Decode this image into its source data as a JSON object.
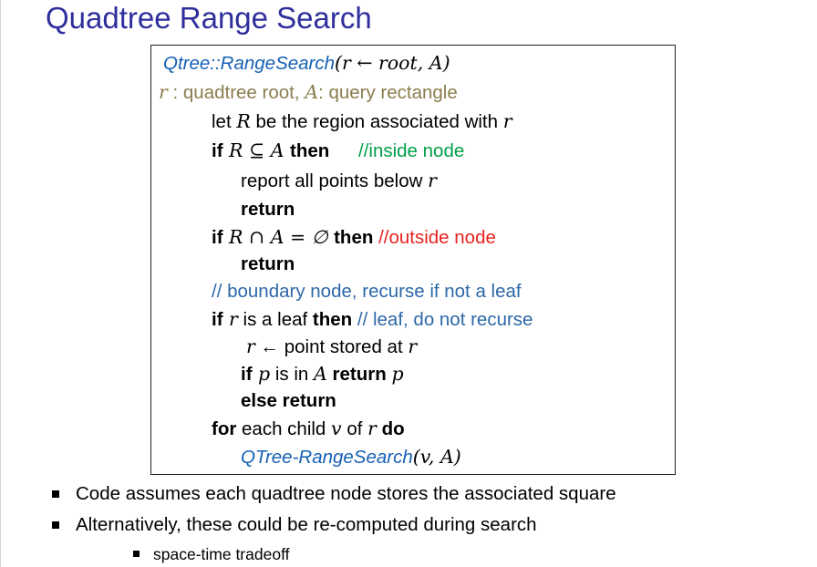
{
  "title": "Quadtree Range Search",
  "code": {
    "signature_fn": "Qtree::RangeSearch",
    "signature_args": "(r ← root, A)",
    "param_line": {
      "r": "r",
      "r_desc": " : quadtree root, ",
      "A": "A",
      "A_desc": ": query rectangle"
    },
    "line_let": {
      "pre": "let ",
      "R": "R",
      "mid": " be the region associated with ",
      "r": "r"
    },
    "line_if_inside": {
      "if": "if",
      "expr": " R ⊆ A ",
      "then": "then",
      "comment": "//inside node"
    },
    "line_report": {
      "text": "report all points below ",
      "r": "r"
    },
    "line_return1": "return",
    "line_if_outside": {
      "if": "if",
      "expr": " R ∩ A = ∅ ",
      "then": "then",
      "comment": "//outside node"
    },
    "line_return2": "return",
    "line_boundary_comment": "// boundary node, recurse if not a leaf",
    "line_if_leaf": {
      "if": "if",
      "r": " r",
      "mid": " is a leaf  ",
      "then": "then",
      "comment": " // leaf, do not recurse"
    },
    "line_assign": {
      "r": "r",
      "arrow": " ← ",
      "text": "point stored at ",
      "r2": "r"
    },
    "line_if_p": {
      "if": "if",
      "p": " p",
      "mid": " is in ",
      "A": "A",
      "return": " return ",
      "p2": "p"
    },
    "line_else": "else return",
    "line_for": {
      "for": "for",
      "mid": " each child ",
      "v": "v",
      "of": " of ",
      "r": "r",
      "do": " do"
    },
    "line_call": {
      "fn": "QTree-RangeSearch",
      "args": "(v, A)"
    }
  },
  "bullets": [
    "Code assumes  each quadtree node stores the associated square",
    "Alternatively, these could be re-computed during search"
  ],
  "sub_bullets": [
    "space-time tradeoff"
  ]
}
